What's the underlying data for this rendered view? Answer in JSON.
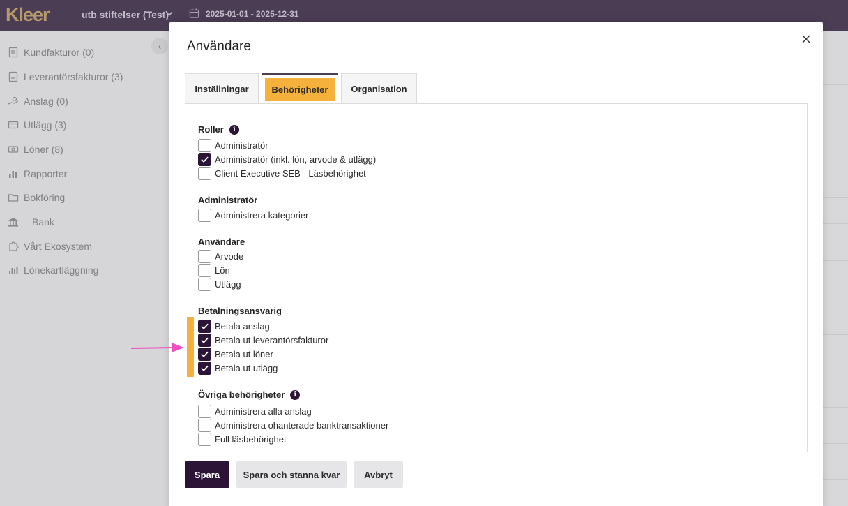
{
  "header": {
    "logo": "Kleer",
    "org_name": "utb stiftelser (Test)",
    "date_range": "2025-01-01 - 2025-12-31"
  },
  "sidebar": {
    "items": [
      {
        "label": "Kundfakturor",
        "count": "(0)",
        "icon": "invoice-icon"
      },
      {
        "label": "Leverantörsfakturor",
        "count": "(3)",
        "icon": "supplier-invoice-icon"
      },
      {
        "label": "Anslag",
        "count": "(0)",
        "icon": "hand-money-icon"
      },
      {
        "label": "Utlägg",
        "count": "(3)",
        "icon": "card-icon"
      },
      {
        "label": "Löner",
        "count": "(8)",
        "icon": "cash-icon"
      },
      {
        "label": "Rapporter",
        "count": "",
        "icon": "bar-chart-icon"
      },
      {
        "label": "Bokföring",
        "count": "",
        "icon": "folder-icon"
      },
      {
        "label": "Bank",
        "count": "",
        "icon": "bank-icon"
      },
      {
        "label": "Vårt Ekosystem",
        "count": "",
        "icon": "puzzle-icon"
      },
      {
        "label": "Lönekartläggning",
        "count": "",
        "icon": "bar-chart-icon"
      }
    ]
  },
  "modal": {
    "title": "Användare",
    "tabs": [
      {
        "label": "Inställningar",
        "active": false
      },
      {
        "label": "Behörigheter",
        "active": true
      },
      {
        "label": "Organisation",
        "active": false
      }
    ],
    "sections": {
      "roller": {
        "title": "Roller",
        "items": [
          {
            "label": "Administratör",
            "checked": false
          },
          {
            "label": "Administratör (inkl. lön, arvode & utlägg)",
            "checked": true
          },
          {
            "label": "Client Executive SEB - Läsbehörighet",
            "checked": false
          }
        ]
      },
      "administrator": {
        "title": "Administratör",
        "items": [
          {
            "label": "Administrera kategorier",
            "checked": false
          }
        ]
      },
      "anvandare": {
        "title": "Användare",
        "items": [
          {
            "label": "Arvode",
            "checked": false
          },
          {
            "label": "Lön",
            "checked": false
          },
          {
            "label": "Utlägg",
            "checked": false
          }
        ]
      },
      "betalningsansvarig": {
        "title": "Betalningsansvarig",
        "items": [
          {
            "label": "Betala anslag",
            "checked": true
          },
          {
            "label": "Betala ut leverantörsfakturor",
            "checked": true
          },
          {
            "label": "Betala ut löner",
            "checked": true
          },
          {
            "label": "Betala ut utlägg",
            "checked": true
          }
        ]
      },
      "ovriga": {
        "title": "Övriga behörigheter",
        "items": [
          {
            "label": "Administrera alla anslag",
            "checked": false
          },
          {
            "label": "Administrera ohanterade banktransaktioner",
            "checked": false
          },
          {
            "label": "Full läsbehörighet",
            "checked": false
          }
        ]
      }
    },
    "buttons": {
      "save": "Spara",
      "save_stay": "Spara och stanna kvar",
      "cancel": "Avbryt"
    }
  },
  "colors": {
    "accent": "#f6b13d",
    "primary": "#2b1436",
    "topbar": "#4a3d54",
    "annotation_arrow": "#ee4fc1"
  }
}
